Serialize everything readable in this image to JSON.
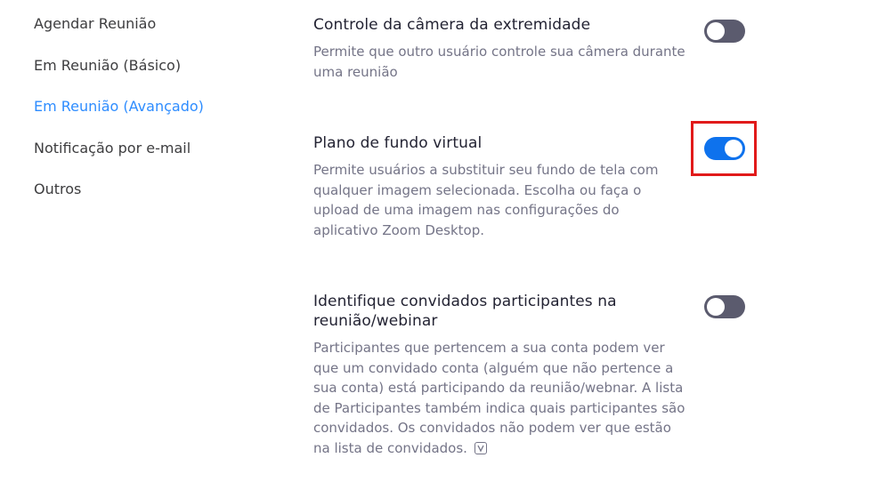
{
  "sidebar": {
    "items": [
      {
        "label": "Agendar Reunião",
        "active": false
      },
      {
        "label": "Em Reunião (Básico)",
        "active": false
      },
      {
        "label": "Em Reunião (Avançado)",
        "active": true
      },
      {
        "label": "Notificação por e-mail",
        "active": false
      },
      {
        "label": "Outros",
        "active": false
      }
    ]
  },
  "settings": [
    {
      "title": "Controle da câmera da extremidade",
      "description": "Permite que outro usuário controle sua câmera durante uma reunião",
      "enabled": false
    },
    {
      "title": "Plano de fundo virtual",
      "description": "Permite usuários a substituir seu fundo de tela com qualquer imagem selecionada. Escolha ou faça o upload de uma imagem nas configurações do aplicativo Zoom Desktop.",
      "enabled": true,
      "highlighted": true
    },
    {
      "title": "Identifique convidados participantes na reunião/webinar",
      "description": "Participantes que pertencem a sua conta podem ver que um convidado conta (alguém que não pertence a sua conta) está participando da reunião/webnar. A lista de Participantes também indica quais participantes são convidados. Os convidados não podem ver que estão na lista de convidados.",
      "enabled": false
    }
  ],
  "colors": {
    "accent": "#2d8cff",
    "toggle_on": "#0e72ed",
    "toggle_off": "#5b5b6e",
    "highlight_border": "#e11a1a"
  },
  "icons": {
    "info": "info-v-icon"
  }
}
